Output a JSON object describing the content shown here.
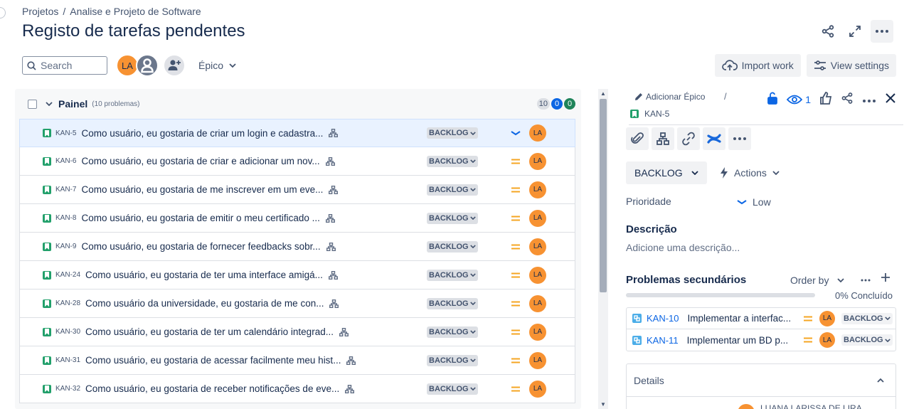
{
  "breadcrumb": {
    "root": "Projetos",
    "separator": "/",
    "project": "Analise e Projeto de Software"
  },
  "page": {
    "title": "Registo de tarefas pendentes"
  },
  "toolbar": {
    "search_placeholder": "Search",
    "avatar_initials": "LA",
    "epic_filter": "Épico",
    "import_label": "Import work",
    "view_settings_label": "View settings"
  },
  "panel": {
    "title": "Painel",
    "count_label": "(10 problemas)",
    "counts": {
      "todo": "10",
      "in_progress": "0",
      "done": "0"
    }
  },
  "issues": [
    {
      "key": "KAN-5",
      "summary": "Como usuário, eu gostaria de criar um login e cadastra...",
      "status": "BACKLOG",
      "priority": "low",
      "assignee": "LA",
      "selected": true
    },
    {
      "key": "KAN-6",
      "summary": "Como usuário, eu gostaria de criar e adicionar um nov...",
      "status": "BACKLOG",
      "priority": "medium",
      "assignee": "LA"
    },
    {
      "key": "KAN-7",
      "summary": "Como usuário, eu gostaria de me inscrever em um eve...",
      "status": "BACKLOG",
      "priority": "medium",
      "assignee": "LA"
    },
    {
      "key": "KAN-8",
      "summary": "Como usuário, eu gostaria de emitir o meu certificado ...",
      "status": "BACKLOG",
      "priority": "medium",
      "assignee": "LA"
    },
    {
      "key": "KAN-9",
      "summary": "Como usuário, eu gostaria de fornecer feedbacks sobr...",
      "status": "BACKLOG",
      "priority": "medium",
      "assignee": "LA"
    },
    {
      "key": "KAN-24",
      "summary": "Como usuário, eu gostaria de ter uma interface amigá...",
      "status": "BACKLOG",
      "priority": "medium",
      "assignee": "LA"
    },
    {
      "key": "KAN-28",
      "summary": "Como usuário da universidade, eu gostaria de me con...",
      "status": "BACKLOG",
      "priority": "medium",
      "assignee": "LA"
    },
    {
      "key": "KAN-30",
      "summary": "Como usuário, eu gostaria de ter um calendário integrad...",
      "status": "BACKLOG",
      "priority": "medium",
      "assignee": "LA"
    },
    {
      "key": "KAN-31",
      "summary": "Como usuário, eu gostaria de acessar facilmente meu hist...",
      "status": "BACKLOG",
      "priority": "medium",
      "assignee": "LA"
    },
    {
      "key": "KAN-32",
      "summary": "Como usuário, eu gostaria de receber notificações de eve...",
      "status": "BACKLOG",
      "priority": "medium",
      "assignee": "LA"
    }
  ],
  "detail": {
    "add_epic": "Adicionar Épico",
    "separator": "/",
    "issue_key": "KAN-5",
    "watchers": "1",
    "status_button": "BACKLOG",
    "actions_label": "Actions",
    "priority_label": "Prioridade",
    "priority_value": "Low",
    "description_title": "Descrição",
    "description_placeholder": "Adicione uma descrição...",
    "subtasks_title": "Problemas secundários",
    "order_by": "Order by",
    "progress_percent": 0,
    "progress_label": "0% Concluído",
    "children": [
      {
        "key": "KAN-10",
        "summary": "Implementar a interfac...",
        "assignee": "LA",
        "status": "BACKLOG"
      },
      {
        "key": "KAN-11",
        "summary": "Implementar um BD p...",
        "assignee": "LA",
        "status": "BACKLOG"
      }
    ],
    "details_label": "Details",
    "assignee_peek": "LUANA LARISSA DE LIRA"
  },
  "colors": {
    "accent": "#0c66e4",
    "story": "#22a06b",
    "avatar": "#f79232",
    "priority_medium": "#f5a623",
    "priority_low": "#0c66e4"
  }
}
